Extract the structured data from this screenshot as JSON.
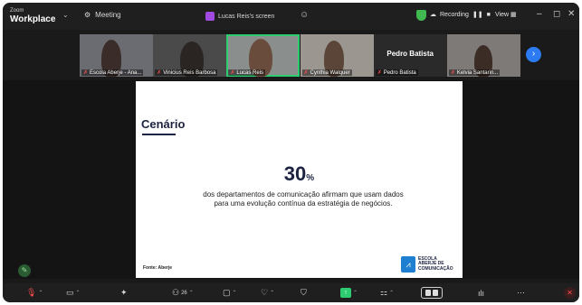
{
  "app": {
    "brand_small": "Zoom",
    "brand_big": "Workplace"
  },
  "titlebar": {
    "meeting_label": "Meeting",
    "share_label": "Lucas Reis's screen",
    "recording_label": "Recording",
    "view_label": "View"
  },
  "gallery": {
    "tiles": [
      {
        "name": "Escola Aberje - Ana..."
      },
      {
        "name": "Vinicius Reis Barbosa"
      },
      {
        "name": "Lucas Reis"
      },
      {
        "name": "Cynthia Walquer"
      },
      {
        "name": "Pedro Batista",
        "big_name": "Pedro Batista"
      },
      {
        "name": "Kelvia Santarin..."
      }
    ]
  },
  "slide": {
    "title": "Cenário",
    "big_number": "30",
    "big_number_unit": "%",
    "body": "dos departamentos de comunicação afirmam que usam dados para uma evolução contínua da estratégia de negócios.",
    "source": "Fonte: Aberje",
    "logo_line1": "ESCOLA",
    "logo_line2": "ABERJE DE",
    "logo_line3": "COMUNICAÇÃO"
  },
  "toolbar": {
    "participants_count": "26"
  },
  "colors": {
    "accent_green": "#2ecc71",
    "mic_off_red": "#ff4d4d",
    "slide_navy": "#1c2340",
    "next_blue": "#2d7bf3"
  }
}
